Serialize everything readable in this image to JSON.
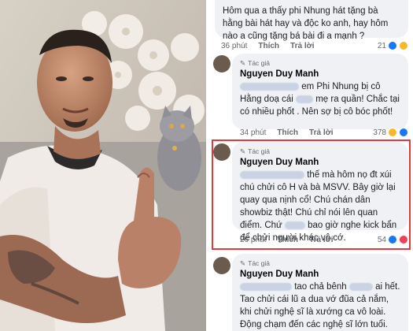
{
  "comments": [
    {
      "text": "Hôm qua a thấy phi Nhung hát tặng bà hằng bài hát hay và độc ko anh, hay hôm nào a cũng tặng bá bài đi a mạnh ?",
      "time": "36 phút",
      "like": "Thích",
      "reply": "Trả lời",
      "count": "21"
    },
    {
      "badge": "Tác giả",
      "author": "Nguyen Duy Manh",
      "text_a": "em Phi Nhung bị cô",
      "text_b": "Hằng doạ cái",
      "text_c": "mẹ ra quần! Chắc tại có nhiều phốt . Nên sợ bị cô bóc phốt!",
      "time": "34 phút",
      "like": "Thích",
      "reply": "Trả lời",
      "count": "378"
    },
    {
      "badge": "Tác giả",
      "author": "Nguyen Duy Manh",
      "text_a": "thế mà hôm nọ đt xúi chú chửi cô H và bà MSVV. Bây giờ lại quay qua nịnh cổ! Chú chán dân showbiz thật! Chú chỉ nói lên quan điểm. Chứ",
      "text_b": "bao giờ nghe kick bẩn để chửi người khác vô cớ.",
      "time": "26 phút",
      "like": "Thích",
      "reply": "Trả lời",
      "count": "54"
    },
    {
      "badge": "Tác giả",
      "author": "Nguyen Duy Manh",
      "text_a": "tao chả bênh",
      "text_b": "ai hết. Tao chửi cái lũ a dua vớ đũa cả nắm, khi chửi nghệ sĩ là xướng ca vô loài. Động chạm đến các nghệ sĩ lớn tuổi. Thì tao phải bênh họ. Con cái"
    }
  ],
  "colors": {
    "highlight": "#e0383c",
    "bubble": "#eff1f4",
    "muted": "#65676b"
  },
  "icons": [
    "pencil-icon",
    "haha-emoji-icon",
    "like-emoji-icon",
    "love-emoji-icon"
  ]
}
